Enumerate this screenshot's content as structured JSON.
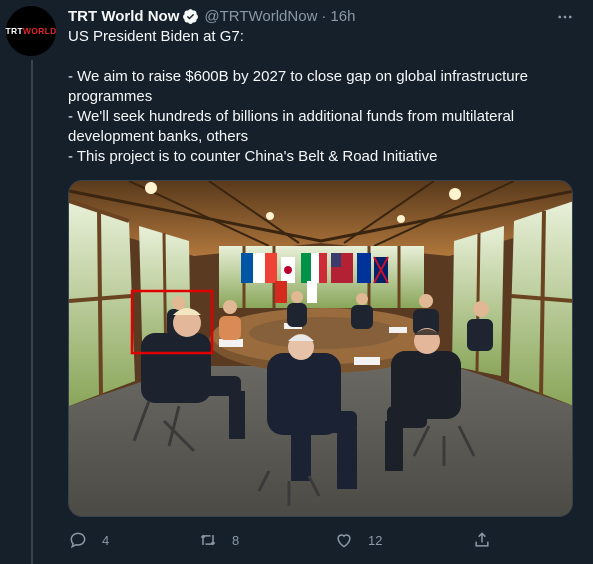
{
  "account": {
    "avatar_text_a": "TRT",
    "avatar_text_b": "WORLD",
    "display_name": "TRT World Now",
    "handle": "@TRTWorldNow",
    "separator": "·",
    "time": "16h",
    "verified_icon": "verified-badge-icon"
  },
  "tweet": {
    "lines": [
      "US President Biden at G7:",
      "",
      "- We aim to raise $600B by 2027 to close gap on global infrastructure programmes",
      "- We'll seek hundreds of billions in additional funds from multilateral development banks, others",
      "- This project is to counter China's Belt & Road Initiative"
    ]
  },
  "actions": {
    "reply_count": "4",
    "retweet_count": "8",
    "like_count": "12",
    "share_count": ""
  },
  "colors": {
    "background": "#15202b",
    "text": "#f7f9f9",
    "muted": "#8b98a5",
    "verified": "#1d9bf0",
    "annotation_box": "#e00000"
  },
  "icons": [
    "more-icon",
    "reply-icon",
    "retweet-icon",
    "like-icon",
    "share-icon",
    "verified-badge-icon"
  ]
}
